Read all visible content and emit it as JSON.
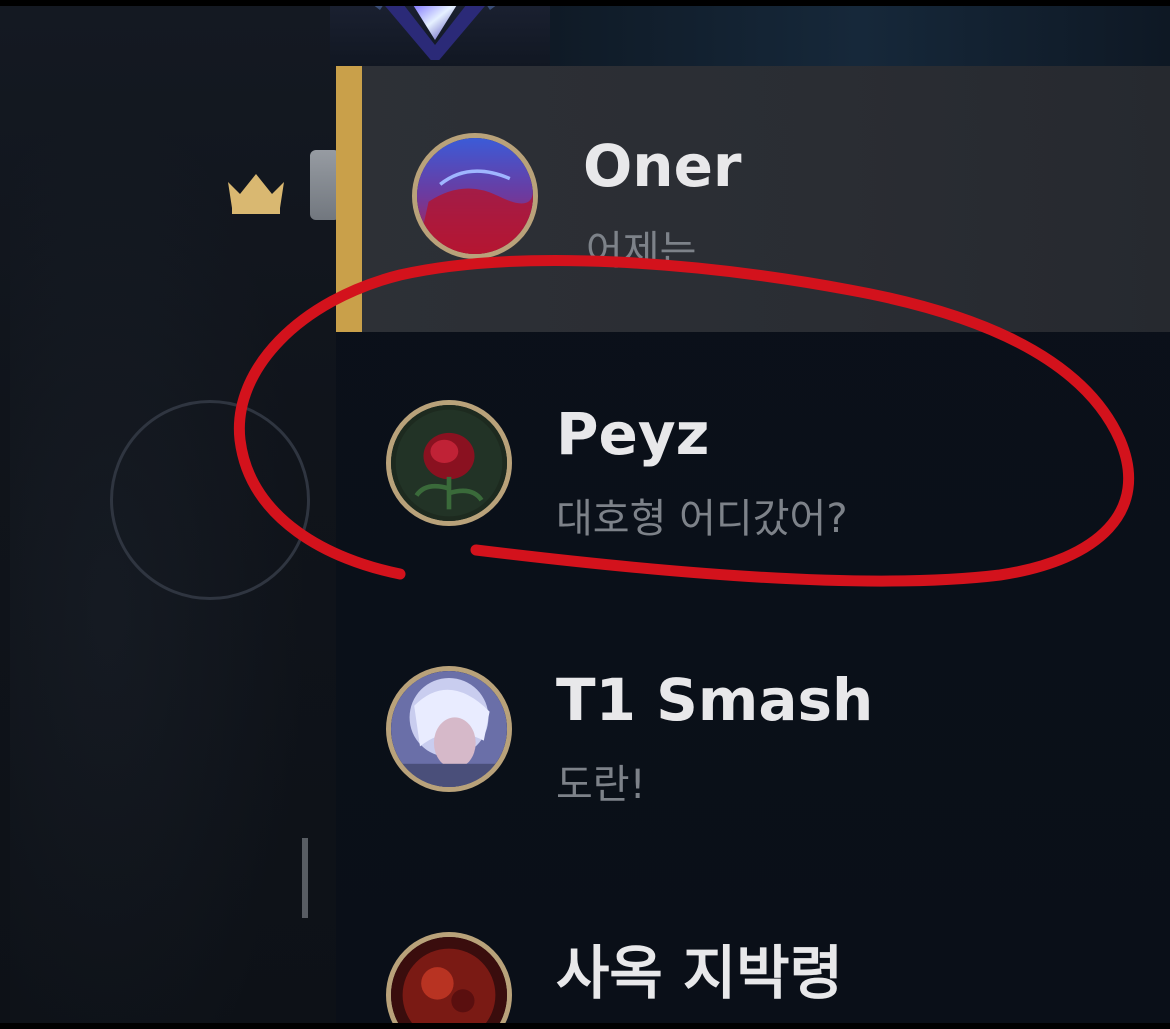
{
  "friends": [
    {
      "name": "Oner",
      "status": "어제는",
      "selected": true,
      "avatar_icon": "red-blue-dragon-icon"
    },
    {
      "name": "Peyz",
      "status": "대호형 어디갔어?",
      "selected": false,
      "avatar_icon": "rose-icon"
    },
    {
      "name": "T1 Smash",
      "status": "도란!",
      "selected": false,
      "avatar_icon": "champion-portrait-icon"
    },
    {
      "name": "사옥 지박령",
      "status": "",
      "selected": false,
      "avatar_icon": "red-champion-icon"
    }
  ],
  "colors": {
    "selected_bar": "#c9a04a",
    "annotation_circle": "#d3121c",
    "name_text": "#e8e8ea",
    "status_text": "#7d8289"
  }
}
